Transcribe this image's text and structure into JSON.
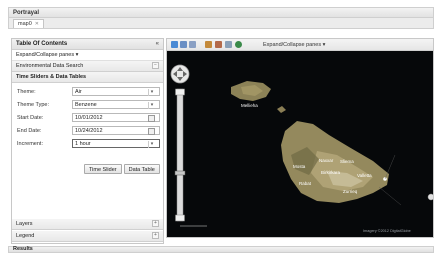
{
  "portal": {
    "title": "Portrayal"
  },
  "tabs": [
    {
      "label": "map0",
      "close": "✕"
    }
  ],
  "toc": {
    "title": "Table Of Contents",
    "collapse": "«",
    "expand_label": "Expand/Collapse panes ▾",
    "env_search": "Environmental Data Search",
    "time_sliders": "Time Sliders & Data Tables"
  },
  "form": {
    "theme": {
      "label": "Theme:",
      "value": "Air"
    },
    "theme_type": {
      "label": "Theme Type:",
      "value": "Benzene"
    },
    "start_date": {
      "label": "Start Date:",
      "value": "10/01/2012"
    },
    "end_date": {
      "label": "End Date:",
      "value": "10/24/2012"
    },
    "increment": {
      "label": "Increment:",
      "value": "1 hour"
    }
  },
  "buttons": {
    "time_slider": "Time Slider",
    "data_table": "Data Table"
  },
  "sections": {
    "layers": "Layers",
    "legend": "Legend"
  },
  "map": {
    "toolbar_label": "Expand/Collapse panes ▾",
    "labels": [
      "Mellieha",
      "Mosta",
      "Naxxar",
      "Sliema",
      "Valletta",
      "Birkirkara",
      "Rabat",
      "Zurrieq"
    ],
    "attribution": "Imagery ©2012 DigitalGlobe"
  },
  "results": {
    "title": "Results"
  }
}
